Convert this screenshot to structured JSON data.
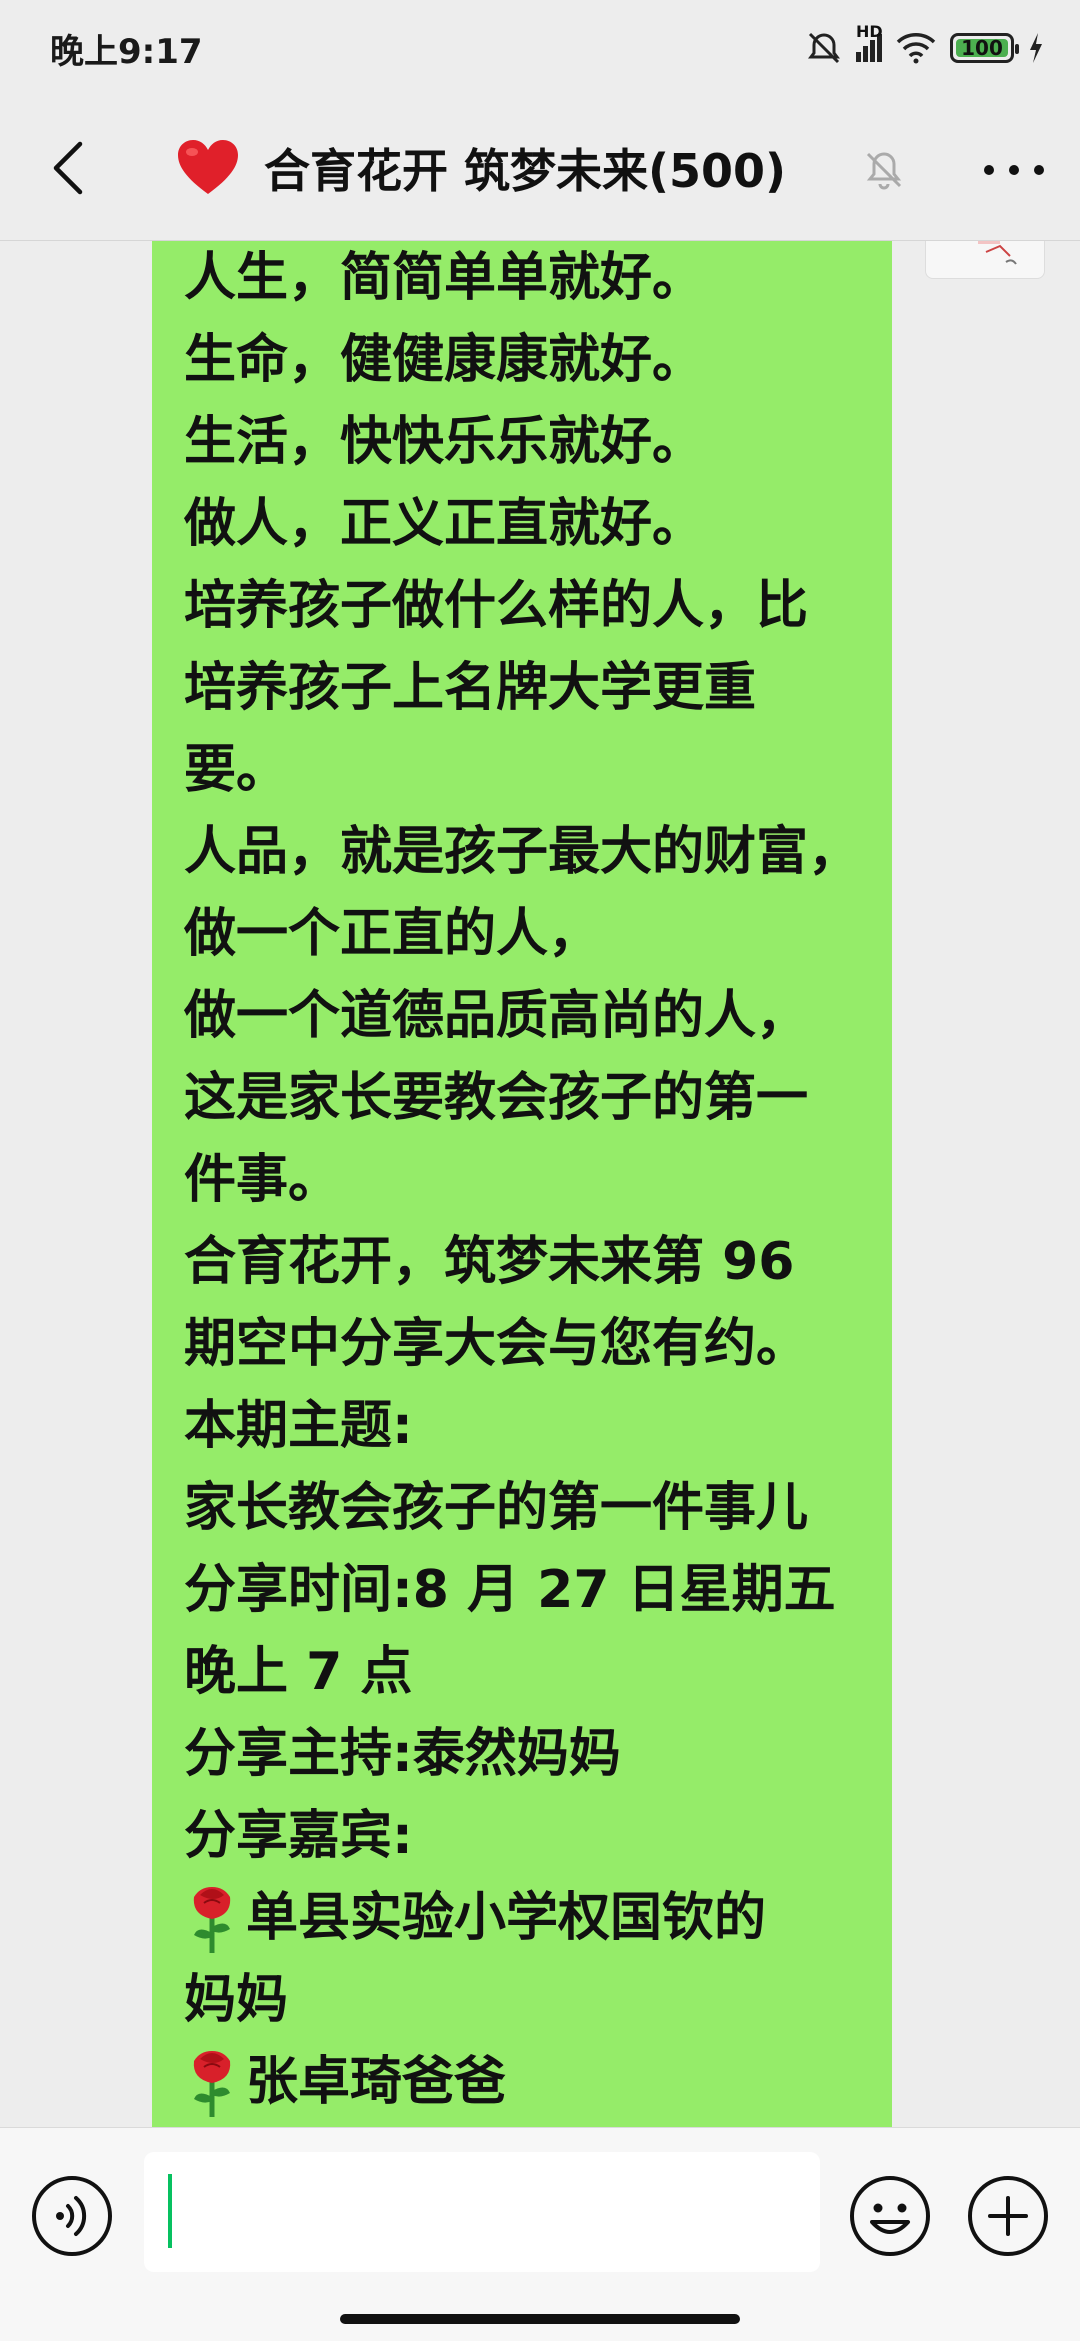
{
  "status_bar": {
    "time": "晚上9:17",
    "network_label": "HD",
    "battery": "100"
  },
  "header": {
    "title": "合育花开 筑梦未来(500)",
    "icons": [
      "back-icon",
      "heart-icon",
      "mute-bell-icon",
      "more-icon"
    ]
  },
  "message": {
    "lines": [
      "人生，简简单单就好。",
      "生命，健健康康就好。",
      "生活，快快乐乐就好。",
      "做人，正义正直就好。",
      "培养孩子做什么样的人，比",
      "培养孩子上名牌大学更重",
      "要。",
      "人品，就是孩子最大的财富，",
      "做一个正直的人，",
      "做一个道德品质高尚的人，",
      "这是家长要教会孩子的第一",
      "件事。",
      "合育花开，筑梦未来第 96",
      "期空中分享大会与您有约。",
      "本期主题:",
      "家长教会孩子的第一件事儿",
      "分享时间:8 月 27 日星期五",
      "晚上 7 点",
      "分享主持:泰然妈妈",
      "分享嘉宾:"
    ],
    "guests": [
      "单县实验小学权国钦的",
      "妈妈",
      "张卓琦爸爸"
    ]
  },
  "input_bar": {
    "text_value": "",
    "icons": [
      "voice-icon",
      "emoji-icon",
      "plus-icon"
    ]
  }
}
